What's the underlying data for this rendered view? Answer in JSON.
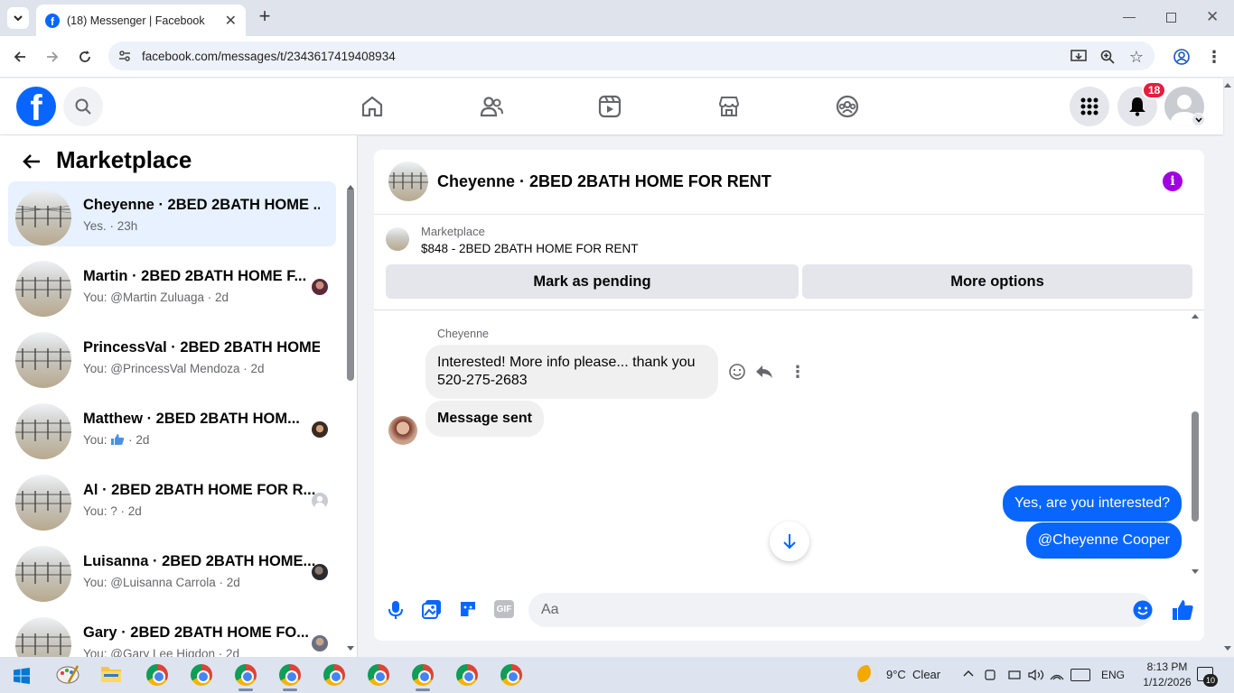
{
  "browser": {
    "tab_title": "(18) Messenger | Facebook",
    "url": "facebook.com/messages/t/2343617419408934"
  },
  "header": {
    "notification_count": "18"
  },
  "sidebar": {
    "title": "Marketplace",
    "conversations": [
      {
        "name": "Cheyenne · 2BED 2BATH HOME ...",
        "subtitle": "Yes. · 23h",
        "active": true
      },
      {
        "name": "Martin · 2BED 2BATH HOME F...",
        "subtitle": "You: @Martin Zuluaga · 2d"
      },
      {
        "name": "PrincessVal · 2BED 2BATH HOME...",
        "subtitle": "You: @PrincessVal Mendoza · 2d"
      },
      {
        "name": "Matthew · 2BED 2BATH HOM...",
        "subtitle_prefix": "You:",
        "subtitle": "· 2d"
      },
      {
        "name": "Al · 2BED 2BATH HOME FOR R...",
        "subtitle": "You: ? · 2d"
      },
      {
        "name": "Luisanna · 2BED 2BATH HOME...",
        "subtitle": "You: @Luisanna Carrola · 2d"
      },
      {
        "name": "Gary · 2BED 2BATH HOME FO...",
        "subtitle": "You: @Gary Lee Higdon · 2d"
      }
    ]
  },
  "chat": {
    "title": "Cheyenne · 2BED 2BATH HOME FOR RENT",
    "listing_label": "Marketplace",
    "listing_text": "$848 - 2BED 2BATH HOME FOR RENT",
    "mark_pending_label": "Mark as pending",
    "more_options_label": "More options",
    "sender_name": "Cheyenne",
    "messages": {
      "incoming_1_line1": "Interested! More info please... thank you",
      "incoming_1_line2": "520-275-2683",
      "incoming_2": "Message sent",
      "outgoing_1": "Yes, are you interested?",
      "outgoing_2": "@Cheyenne Cooper"
    },
    "composer_placeholder": "Aa",
    "gif_label": "GIF"
  },
  "taskbar": {
    "weather": "9°C  Clear",
    "language": "ENG",
    "time": "8:13 PM",
    "date": "1/12/2026",
    "notification_count": "10"
  },
  "colors": {
    "brand_blue": "#0866ff",
    "active_conversation": "#e7f1ff",
    "badge_red": "#e41e3f",
    "info_purple": "#a100e0"
  }
}
